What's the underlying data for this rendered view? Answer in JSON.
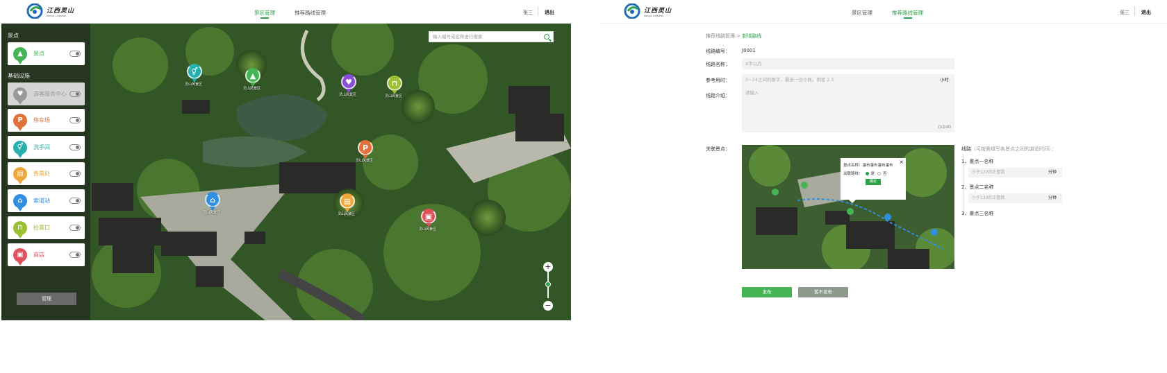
{
  "brand": {
    "name_cn": "江西灵山",
    "name_en": "Jiangxi Lingshan"
  },
  "left": {
    "nav": [
      {
        "label": "景区管理",
        "active": true
      },
      {
        "label": "推荐路线管理",
        "active": false
      }
    ],
    "user": "张三",
    "logout": "退出",
    "search_placeholder": "输入编号或名称进行搜索",
    "sidebar": {
      "section_scenic": "景点",
      "section_facility": "基础设施",
      "items": [
        {
          "label": "景点",
          "icon": "mountain-icon",
          "color": "#45b455",
          "disabled": false
        },
        {
          "label": "游客服务中心",
          "icon": "visitor-center-icon",
          "color": "#999999",
          "disabled": true
        },
        {
          "label": "停车场",
          "icon": "parking-icon",
          "color": "#e2703a",
          "disabled": false
        },
        {
          "label": "洗手间",
          "icon": "restroom-icon",
          "color": "#26b0b0",
          "disabled": false
        },
        {
          "label": "售票处",
          "icon": "ticket-office-icon",
          "color": "#f0a73a",
          "disabled": false
        },
        {
          "label": "索道站",
          "icon": "cableway-icon",
          "color": "#2f8fe0",
          "disabled": false
        },
        {
          "label": "检票口",
          "icon": "ticket-gate-icon",
          "color": "#9cc033",
          "disabled": false
        },
        {
          "label": "商店",
          "icon": "shop-icon",
          "color": "#e0505a",
          "disabled": false
        }
      ],
      "manage_label": "管理"
    },
    "pins": [
      {
        "icon": "restroom-icon",
        "color": "#26b0b0",
        "label": "灵山风景区"
      },
      {
        "icon": "mountain-icon",
        "color": "#45b455",
        "label": "灵山风景区"
      },
      {
        "icon": "visitor-center-icon",
        "color": "#8a4fd8",
        "label": "灵山风景区"
      },
      {
        "icon": "ticket-gate-icon",
        "color": "#9cc033",
        "label": "灵山风景区"
      },
      {
        "icon": "parking-icon",
        "color": "#e2703a",
        "label": "灵山风景区"
      },
      {
        "icon": "cableway-icon",
        "color": "#2f8fe0",
        "label": "灵山风景区"
      },
      {
        "icon": "ticket-office-icon",
        "color": "#f0a73a",
        "label": "灵山风景区"
      },
      {
        "icon": "shop-icon",
        "color": "#e0505a",
        "label": "灵山风景区"
      }
    ]
  },
  "right": {
    "nav": [
      {
        "label": "景区管理",
        "active": false
      },
      {
        "label": "推荐路线管理",
        "active": true
      }
    ],
    "user": "张三",
    "logout": "退出",
    "breadcrumb": {
      "parent": "推荐线路管理",
      "sep": ">",
      "current": "新增路线"
    },
    "form": {
      "code_label": "线路编号：",
      "code_value": "J0001",
      "name_label": "线路名称：",
      "name_placeholder": "8字以内",
      "time_label": "参考用时：",
      "time_placeholder": "0~24之间的数字，最多一位小数。例如 2.5",
      "time_unit": "小时",
      "intro_label": "线路介绍：",
      "intro_placeholder": "请输入",
      "intro_count": "0/240",
      "spots_label": "关联景点："
    },
    "popup": {
      "name_label": "景点名称：",
      "name_value": "瀑布瀑布瀑布瀑布",
      "link_label": "关联路线：",
      "yes": "是",
      "no": "否",
      "ok": "确定",
      "close": "×"
    },
    "route": {
      "title": "线路",
      "hint": "（可按需填写各景点之间的游览时间）：",
      "items": [
        {
          "label": "1、景点一名称"
        },
        {
          "label": "2、景点二名称"
        },
        {
          "label": "3、景点三名称"
        }
      ],
      "input_placeholder": "小于120的正整数",
      "unit": "分钟"
    },
    "buttons": {
      "publish": "发布",
      "draft": "暂不发布"
    }
  }
}
